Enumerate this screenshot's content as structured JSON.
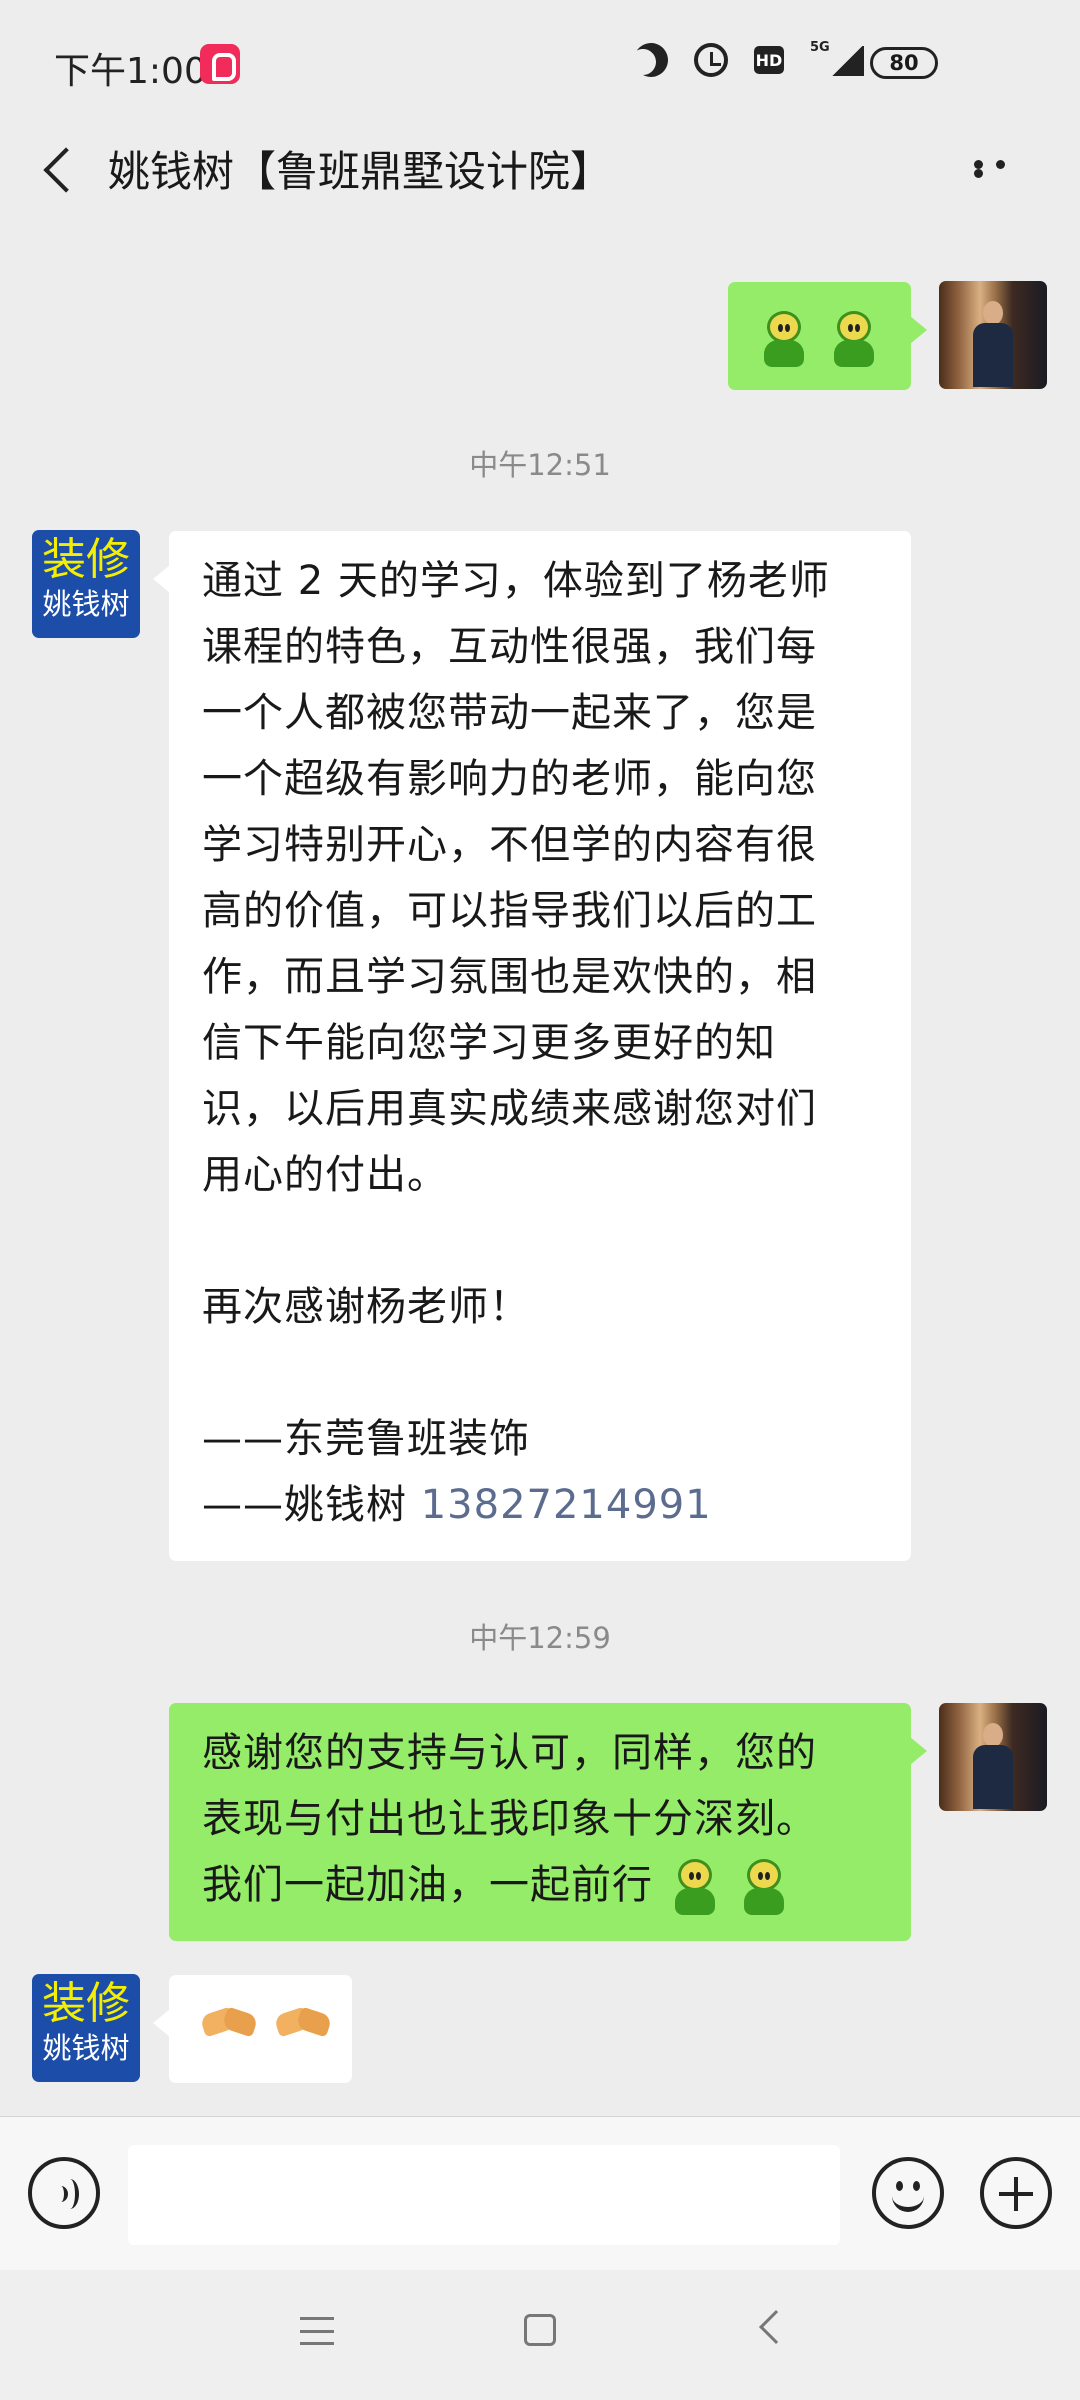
{
  "status_bar": {
    "time": "下午1:00",
    "network": "5G",
    "hd": "HD",
    "battery": "80",
    "icons": [
      "app-icon",
      "moon-icon",
      "alarm-icon",
      "hd-icon",
      "signal-icon",
      "battery-icon"
    ]
  },
  "header": {
    "title": "姚钱树【鲁班鼎墅设计院】",
    "back_icon": "back-icon",
    "more_icon": "more-icon"
  },
  "chat": {
    "timestamps": [
      "中午12:51",
      "中午12:59"
    ],
    "other_avatar": {
      "line1": "装修",
      "line2": "姚钱树"
    },
    "messages": [
      {
        "side": "right",
        "emoji_count": 2
      },
      {
        "side": "left",
        "paragraph1_lines": [
          "通过 2 天的学习，体验到了杨老师",
          "课程的特色，互动性很强，我们每",
          "一个人都被您带动一起来了，您是",
          "一个超级有影响力的老师，能向您",
          "学习特别开心，不但学的内容有很",
          "高的价值，可以指导我们以后的工",
          "作，而且学习氛围也是欢快的，相",
          "信下午能向您学习更多更好的知",
          "识，以后用真实成绩来感谢您对们",
          "用心的付出。"
        ],
        "paragraph2": "再次感谢杨老师！",
        "signature1": "——东莞鲁班装饰",
        "signature2_prefix": "——姚钱树 ",
        "phone": "13827214991"
      },
      {
        "side": "right",
        "lines": [
          "感谢您的支持与认可，同样，您的",
          "表现与付出也让我印象十分深刻。",
          "我们一起加油，一起前行"
        ]
      },
      {
        "side": "left",
        "emoji": "handshake-icon"
      }
    ]
  },
  "input_bar": {
    "voice_icon": "voice-icon",
    "input_value": "",
    "emoji_icon": "emoji-icon",
    "plus_icon": "plus-icon"
  },
  "navigation": {
    "icons": [
      "menu-icon",
      "home-icon",
      "back-icon"
    ]
  },
  "colors": {
    "background": "#ededed",
    "sent_bubble": "#95ec69",
    "received_bubble": "#ffffff",
    "phone_link": "#5b6c8f"
  }
}
